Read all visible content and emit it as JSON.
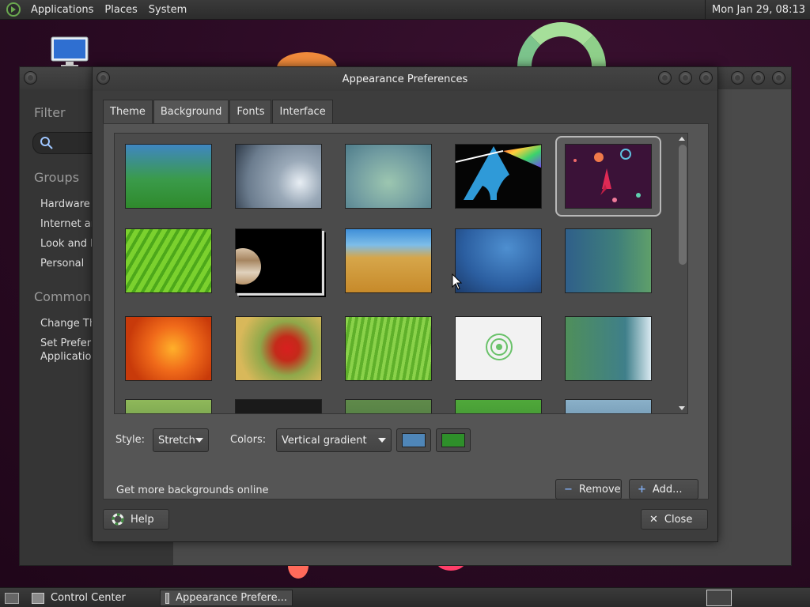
{
  "top_panel": {
    "menus": [
      "Applications",
      "Places",
      "System"
    ],
    "clock": "Mon Jan 29, 08:13"
  },
  "control_center": {
    "filter_heading": "Filter",
    "groups_heading": "Groups",
    "groups": [
      "Hardware",
      "Internet an",
      "Look and F",
      "Personal"
    ],
    "common_heading": "Common T",
    "common_items": [
      "Change Th",
      "Set Preferre",
      "Application"
    ]
  },
  "dialog": {
    "title": "Appearance Preferences",
    "tabs": [
      "Theme",
      "Background",
      "Fonts",
      "Interface"
    ],
    "active_tab": "Background",
    "style_label": "Style:",
    "style_value": "Stretch",
    "colors_label": "Colors:",
    "colors_value": "Vertical gradient",
    "primary_color": "#4f86b8",
    "secondary_color": "#2e8f2a",
    "get_more_label": "Get more backgrounds online",
    "remove_label": "Remove",
    "add_label": "Add...",
    "help_label": "Help",
    "close_label": "Close"
  },
  "taskbar": {
    "items": [
      "Control Center",
      "Appearance Prefere..."
    ]
  },
  "wallpapers": [
    "blue-green gradient",
    "water drop",
    "blue-green abstract",
    "arch linux",
    "space rocket",
    "green leaf",
    "jupiter",
    "wheat field",
    "blue ocean",
    "teal gradient",
    "orange flower",
    "red flower",
    "green grass",
    "spiral logo",
    "green-blue gradient",
    "partial 1",
    "partial 2",
    "partial 3",
    "partial 4",
    "partial 5"
  ]
}
